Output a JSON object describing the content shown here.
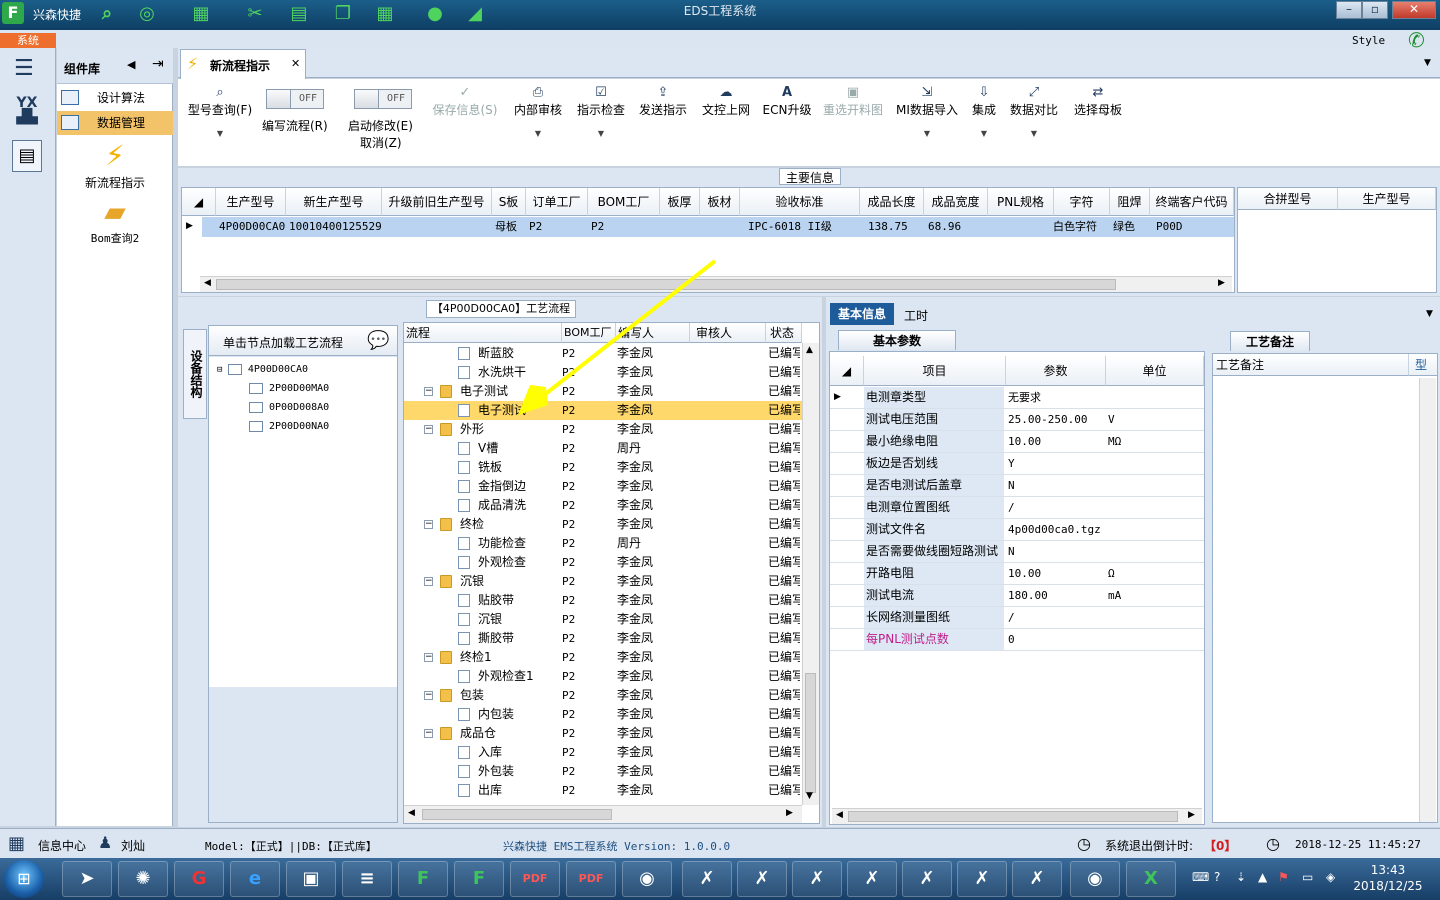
{
  "titlebar": {
    "logo": "F",
    "app_name": "兴森快捷",
    "window_title": "EDS工程系统"
  },
  "menustrip": {
    "system_tab": "系统",
    "style_label": "Style"
  },
  "complib": {
    "title": "组件库",
    "items": [
      {
        "label": "设计算法"
      },
      {
        "label": "数据管理"
      }
    ],
    "big_items": [
      {
        "label": "新流程指示",
        "icon": "lightning-icon"
      },
      {
        "label": "Bom查询2",
        "icon": "folder-icon"
      }
    ]
  },
  "tab": {
    "label": "新流程指示"
  },
  "toolbar": {
    "model_query": "型号查询(F)",
    "write_flow": "编写流程(R)",
    "toggle_off": "OFF",
    "enable_edit": "启动修改(E)",
    "cancel": "取消(Z)",
    "save_info": "保存信息(S)",
    "internal_review": "内部审核",
    "check_indication": "指示检查",
    "send_indication": "发送指示",
    "upload": "文控上网",
    "ecn_upgrade": "ECN升级",
    "reselect_image": "重选开料图",
    "mi_import": "MI数据导入",
    "integrate": "集成",
    "compare": "数据对比",
    "choose_master": "选择母板"
  },
  "main_info": {
    "title": "主要信息",
    "columns": [
      "生产型号",
      "新生产型号",
      "升级前旧生产型号",
      "S板",
      "订单工厂",
      "BOM工厂",
      "板厚",
      "板材",
      "验收标准",
      "成品长度",
      "成品宽度",
      "PNL规格",
      "字符",
      "阻焊",
      "终端客户代码"
    ],
    "row": [
      "4P00D00CA0",
      "10010400125529",
      "",
      "母板",
      "P2",
      "P2",
      "",
      "",
      "IPC-6018 II级",
      "138.75",
      "68.96",
      "",
      "白色字符",
      "绿色",
      "P00D"
    ],
    "side_columns": [
      "合拼型号",
      "生产型号"
    ]
  },
  "process": {
    "title": "【4P00D00CA0】工艺流程",
    "side_tab": "设备结构",
    "load_hint": "单击节点加载工艺流程",
    "tree_root": "4P00D00CA0",
    "tree_children": [
      "2P00D00MA0",
      "0P00D008A0",
      "2P00D00NA0"
    ],
    "columns": [
      "流程",
      "BOM工厂",
      "编写人",
      "审核人",
      "状态"
    ],
    "rows": [
      {
        "name": "断蓝胶",
        "factory": "P2",
        "writer": "李金凤",
        "status": "已编写",
        "type": "leaf"
      },
      {
        "name": "水洗烘干",
        "factory": "P2",
        "writer": "李金凤",
        "status": "已编写",
        "type": "leaf"
      },
      {
        "name": "电子测试",
        "factory": "P2",
        "writer": "李金凤",
        "status": "已编写",
        "type": "group"
      },
      {
        "name": "电子测试",
        "factory": "P2",
        "writer": "李金凤",
        "status": "已编写",
        "type": "leaf",
        "selected": true
      },
      {
        "name": "外形",
        "factory": "P2",
        "writer": "李金凤",
        "status": "已编写",
        "type": "group"
      },
      {
        "name": "V槽",
        "factory": "P2",
        "writer": "周丹",
        "status": "已编写",
        "type": "leaf"
      },
      {
        "name": "铣板",
        "factory": "P2",
        "writer": "李金凤",
        "status": "已编写",
        "type": "leaf"
      },
      {
        "name": "金指倒边",
        "factory": "P2",
        "writer": "李金凤",
        "status": "已编写",
        "type": "leaf"
      },
      {
        "name": "成品清洗",
        "factory": "P2",
        "writer": "李金凤",
        "status": "已编写",
        "type": "leaf"
      },
      {
        "name": "终检",
        "factory": "P2",
        "writer": "李金凤",
        "status": "已编写",
        "type": "group"
      },
      {
        "name": "功能检查",
        "factory": "P2",
        "writer": "周丹",
        "status": "已编写",
        "type": "leaf"
      },
      {
        "name": "外观检查",
        "factory": "P2",
        "writer": "李金凤",
        "status": "已编写",
        "type": "leaf"
      },
      {
        "name": "沉银",
        "factory": "P2",
        "writer": "李金凤",
        "status": "已编写",
        "type": "group"
      },
      {
        "name": "贴胶带",
        "factory": "P2",
        "writer": "李金凤",
        "status": "已编写",
        "type": "leaf"
      },
      {
        "name": "沉银",
        "factory": "P2",
        "writer": "李金凤",
        "status": "已编写",
        "type": "leaf"
      },
      {
        "name": "撕胶带",
        "factory": "P2",
        "writer": "李金凤",
        "status": "已编写",
        "type": "leaf"
      },
      {
        "name": "终检1",
        "factory": "P2",
        "writer": "李金凤",
        "status": "已编写",
        "type": "group"
      },
      {
        "name": "外观检查1",
        "factory": "P2",
        "writer": "李金凤",
        "status": "已编写",
        "type": "leaf"
      },
      {
        "name": "包装",
        "factory": "P2",
        "writer": "李金凤",
        "status": "已编写",
        "type": "group"
      },
      {
        "name": "内包装",
        "factory": "P2",
        "writer": "李金凤",
        "status": "已编写",
        "type": "leaf"
      },
      {
        "name": "成品仓",
        "factory": "P2",
        "writer": "李金凤",
        "status": "已编写",
        "type": "group"
      },
      {
        "name": "入库",
        "factory": "P2",
        "writer": "李金凤",
        "status": "已编写",
        "type": "leaf"
      },
      {
        "name": "外包装",
        "factory": "P2",
        "writer": "李金凤",
        "status": "已编写",
        "type": "leaf"
      },
      {
        "name": "出库",
        "factory": "P2",
        "writer": "李金凤",
        "status": "已编写",
        "type": "leaf"
      }
    ]
  },
  "right": {
    "tabs": [
      "基本信息",
      "工时"
    ],
    "basic_params_tab": "基本参数",
    "param_columns": [
      "项目",
      "参数",
      "单位"
    ],
    "params": [
      {
        "k": "电测章类型",
        "v": "无要求",
        "u": ""
      },
      {
        "k": "测试电压范围",
        "v": "25.00-250.00",
        "u": "V"
      },
      {
        "k": "最小绝缘电阻",
        "v": "10.00",
        "u": "MΩ"
      },
      {
        "k": "板边是否划线",
        "v": "Y",
        "u": ""
      },
      {
        "k": "是否电测试后盖章",
        "v": "N",
        "u": ""
      },
      {
        "k": "电测章位置图纸",
        "v": "/",
        "u": ""
      },
      {
        "k": "测试文件名",
        "v": "4p00d00ca0.tgz",
        "u": ""
      },
      {
        "k": "是否需要做线圈短路测试",
        "v": "N",
        "u": ""
      },
      {
        "k": "开路电阻",
        "v": "10.00",
        "u": "Ω"
      },
      {
        "k": "测试电流",
        "v": "180.00",
        "u": "mA"
      },
      {
        "k": "长网络测量图纸",
        "v": "/",
        "u": ""
      },
      {
        "k": "每PNL测试点数",
        "v": "0",
        "u": ""
      }
    ],
    "notes_tab": "工艺备注",
    "notes_col": "工艺备注",
    "notes_col2": "型"
  },
  "statusbar": {
    "info_center": "信息中心",
    "user": "刘灿",
    "model": "Model:【正式】||DB:【正式库】",
    "version": "兴森快捷 EMS工程系统 Version: 1.0.0.0",
    "logout_label": "系统退出倒计时:",
    "logout_value": "【0】",
    "datetime": "2018-12-25 11:45:27"
  },
  "taskbar": {
    "time": "13:43",
    "date": "2018/12/25"
  },
  "colors": {
    "accent": "#1d5b9a",
    "selection": "#ffd86b",
    "row_select": "#b9d3f0",
    "magenta_text": "#c0208a"
  }
}
